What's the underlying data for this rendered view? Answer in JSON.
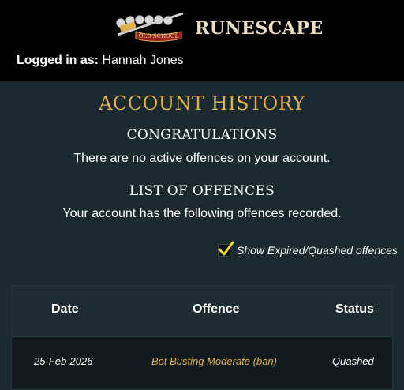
{
  "header": {
    "osrs_logo_text": "OLD SCHOOL",
    "rs_logo_text": "RUNESCAPE",
    "logged_in_label": "Logged in as:",
    "username": "Hannah Jones"
  },
  "page": {
    "title": "ACCOUNT HISTORY",
    "congrats_heading": "CONGRATULATIONS",
    "congrats_text": "There are no active offences on your account.",
    "offences_heading": "LIST OF OFFENCES",
    "offences_text": "Your account has the following offences recorded.",
    "show_expired_label": "Show Expired/Quashed offences",
    "show_expired_checked": true
  },
  "table": {
    "headers": {
      "date": "Date",
      "offence": "Offence",
      "status": "Status"
    },
    "rows": [
      {
        "date": "25-Feb-2026",
        "offence": "Bot Busting Moderate (ban)",
        "status": "Quashed"
      }
    ]
  },
  "colors": {
    "accent_gold": "#e0b24a",
    "background": "#1b2a30",
    "header_bg": "#000000",
    "check_yellow": "#f2e11a"
  }
}
